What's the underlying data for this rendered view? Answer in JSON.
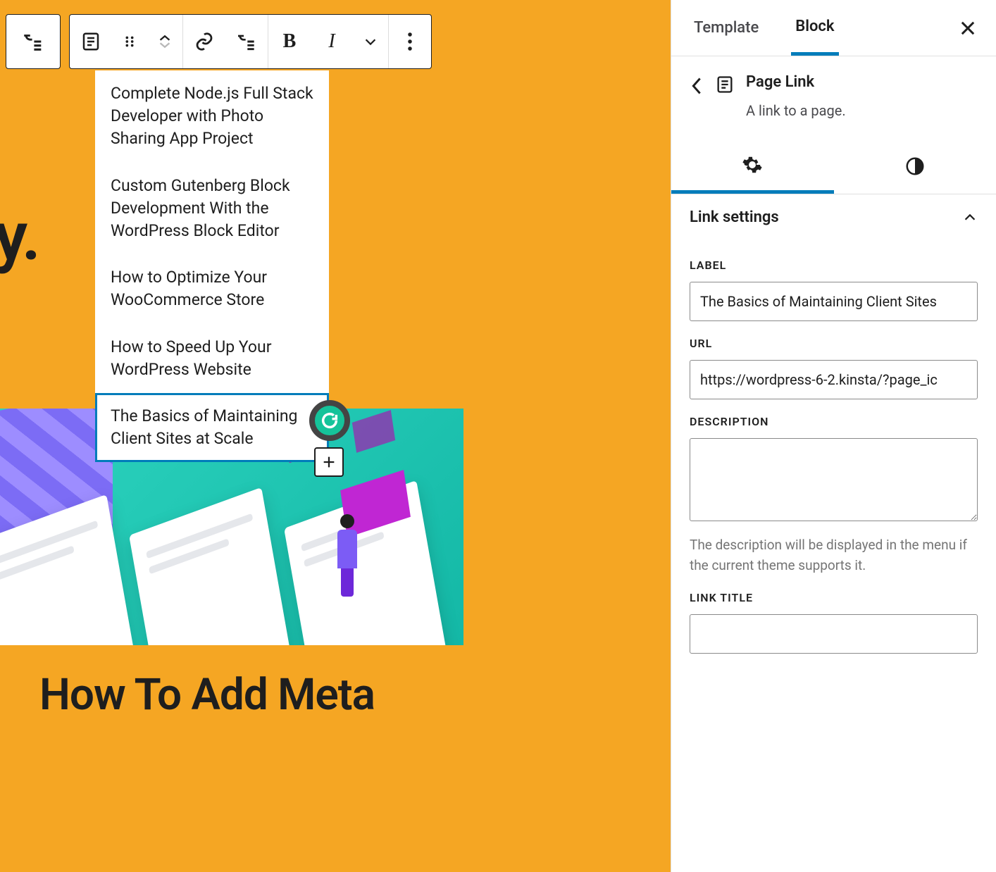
{
  "toolbar": {
    "bold": "B",
    "italic": "I"
  },
  "canvas": {
    "bg_text": "hy.",
    "submenu_items": [
      "Complete Node.js Full Stack Developer with Photo Sharing App Project",
      "Custom Gutenberg Block Development With the WordPress Block Editor",
      "How to Optimize Your WooCommerce Store",
      "How to Speed Up Your WordPress Website",
      "The Basics of Maintaining Client Sites at Scale"
    ],
    "selected_index": 4,
    "bottom_heading": "How To Add Meta"
  },
  "sidebar": {
    "tabs": {
      "template": "Template",
      "block": "Block"
    },
    "breadcrumb": {
      "title": "Page Link",
      "subtitle": "A link to a page."
    },
    "section_title": "Link settings",
    "fields": {
      "label": {
        "label": "LABEL",
        "value": "The Basics of Maintaining Client Sites"
      },
      "url": {
        "label": "URL",
        "value": "https://wordpress-6-2.kinsta/?page_ic"
      },
      "description": {
        "label": "DESCRIPTION",
        "value": "",
        "help": "The description will be displayed in the menu if the current theme supports it."
      },
      "link_title": {
        "label": "LINK TITLE",
        "value": ""
      }
    }
  }
}
